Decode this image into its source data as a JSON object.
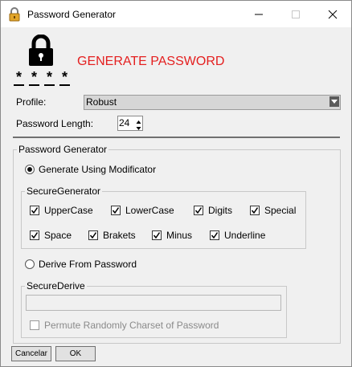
{
  "window": {
    "title": "Password Generator",
    "icon": "padlock-icon",
    "controls": [
      "minimize-icon",
      "maximize-icon",
      "close-icon"
    ]
  },
  "header": {
    "icon": "lock-icon",
    "masked_password": [
      "*",
      "*",
      "*",
      "*"
    ],
    "headline": "GENERATE PASSWORD",
    "headline_color": "#e41f1f"
  },
  "profile": {
    "label": "Profile:",
    "selected": "Robust"
  },
  "length": {
    "label": "Password Length:",
    "value": "24"
  },
  "generator_group": {
    "title": "Password Generator",
    "mode_modificator": {
      "label": "Generate Using Modificator",
      "selected": true
    },
    "secure_generator": {
      "title": "SecureGenerator",
      "options": [
        {
          "label": "UpperCase",
          "checked": true
        },
        {
          "label": "LowerCase",
          "checked": true
        },
        {
          "label": "Digits",
          "checked": true
        },
        {
          "label": "Special",
          "checked": true
        },
        {
          "label": "Space",
          "checked": true
        },
        {
          "label": "Brakets",
          "checked": true
        },
        {
          "label": "Minus",
          "checked": true
        },
        {
          "label": "Underline",
          "checked": true
        }
      ]
    },
    "mode_derive": {
      "label": "Derive From Password",
      "selected": false
    },
    "secure_derive": {
      "title": "SecureDerive",
      "input_value": "",
      "permute": {
        "label": "Permute Randomly Charset of Password",
        "checked": false
      }
    }
  },
  "buttons": {
    "cancel": "Cancelar",
    "ok": "OK"
  }
}
